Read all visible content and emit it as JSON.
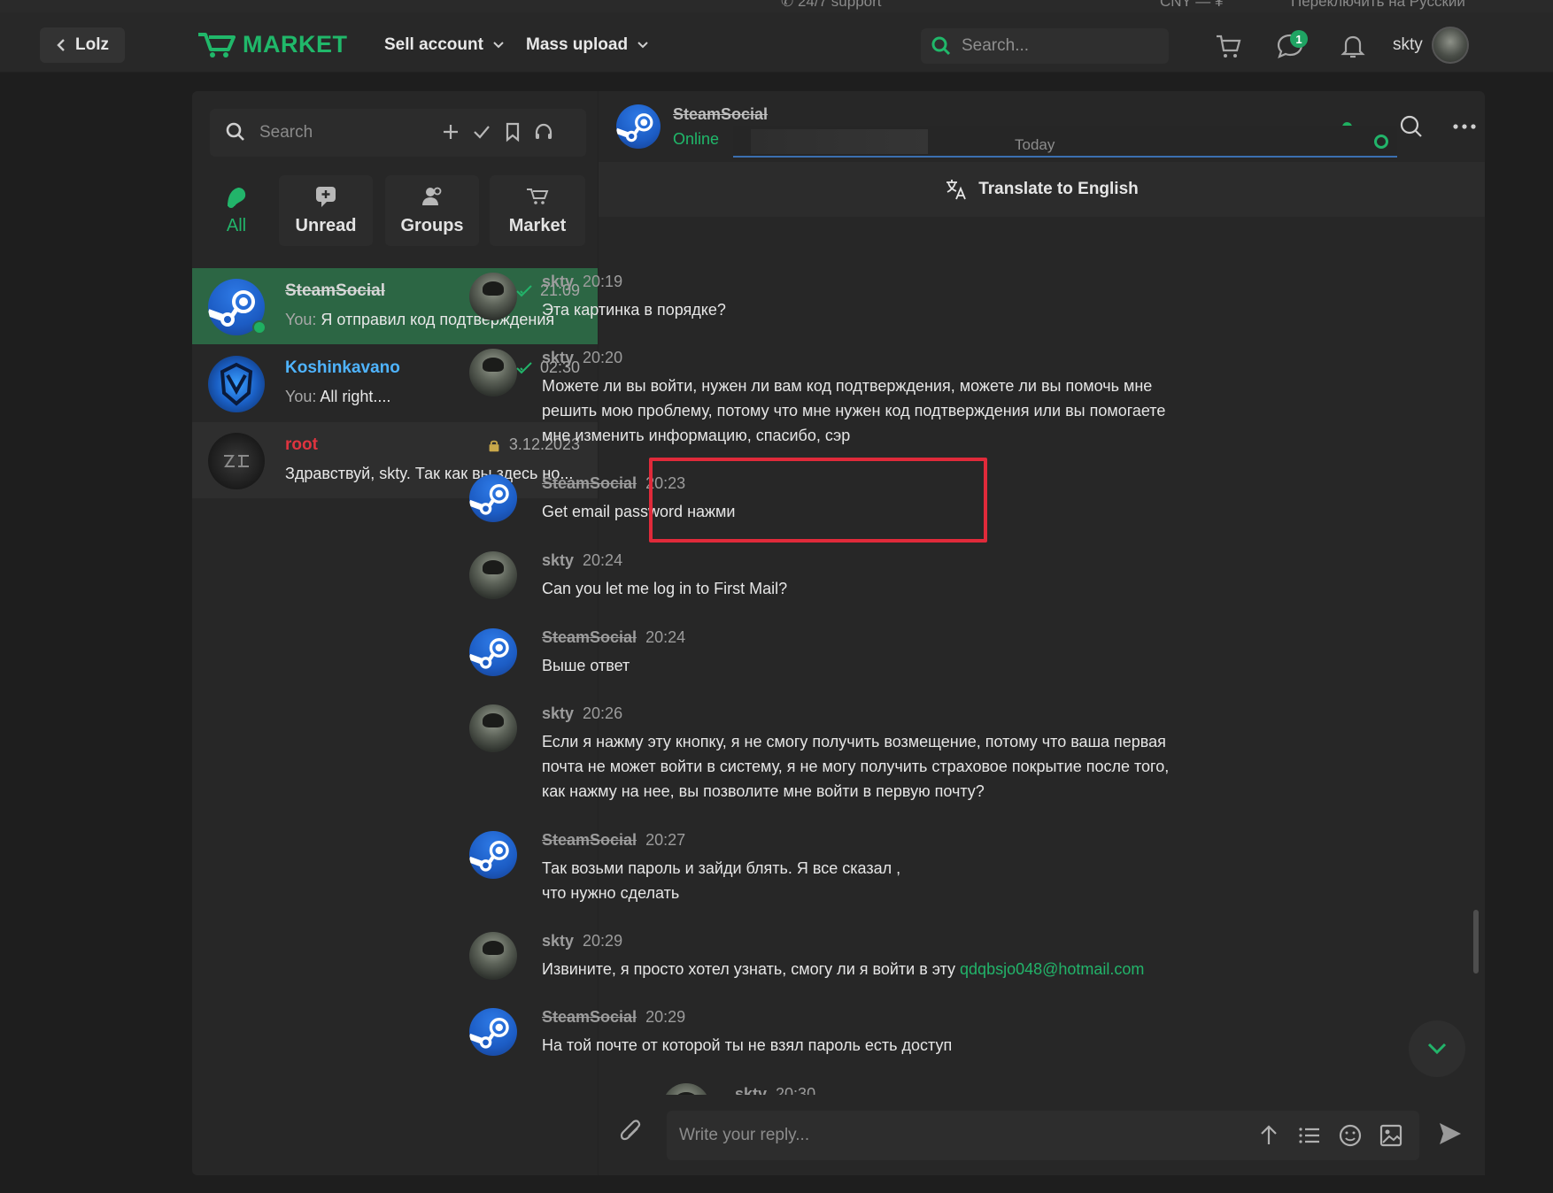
{
  "topbar": {
    "support": "24/7 support",
    "currency": "CNY — ¥",
    "language_switch": "Переключить на Русский"
  },
  "header": {
    "back_label": "Lolz",
    "logo_text": "MARKET",
    "nav": [
      "Sell account",
      "Mass upload"
    ],
    "search_placeholder": "Search...",
    "messages_badge": "1",
    "username": "skty"
  },
  "sidebar": {
    "search_placeholder": "Search",
    "tabs": [
      {
        "label": "All",
        "icon": "all-icon"
      },
      {
        "label": "Unread",
        "icon": "unread-icon"
      },
      {
        "label": "Groups",
        "icon": "groups-icon"
      },
      {
        "label": "Market",
        "icon": "market-icon"
      }
    ],
    "conversations": [
      {
        "name": "SteamSocial",
        "time": "21:09",
        "you": "You:",
        "preview": "Я отправил код подтверждения",
        "name_color": "#bfbfbf"
      },
      {
        "name": "Koshinkavano",
        "time": "02:30",
        "you": "You:",
        "preview": "All right....",
        "name_color": "#4fb4ff"
      },
      {
        "name": "root",
        "time": "3.12.2023",
        "you": "",
        "preview": "Здравствуй, skty. Так как вы здесь но...",
        "name_color": "#e0343f"
      }
    ]
  },
  "chat": {
    "contact_name": "SteamSocial",
    "contact_status": "Online",
    "translate_label": "Translate to English",
    "image_date_label": "Today",
    "reply_placeholder": "Write your reply...",
    "messages": [
      {
        "author": "skty",
        "time": "20:19",
        "lines": [
          "Эта картинка в порядке?"
        ]
      },
      {
        "author": "skty",
        "time": "20:20",
        "lines": [
          "Можете ли вы войти, нужен ли вам код подтверждения, можете ли вы помочь мне",
          "решить мою проблему, потому что мне нужен код подтверждения или вы помогаете",
          "мне изменить информацию, спасибо, сэр"
        ]
      },
      {
        "author": "SteamSocial",
        "time": "20:23",
        "lines": [
          "Get email password нажми"
        ]
      },
      {
        "author": "skty",
        "time": "20:24",
        "lines": [
          "Can you let me log in to First Mail?"
        ]
      },
      {
        "author": "SteamSocial",
        "time": "20:24",
        "lines": [
          "Выше ответ"
        ]
      },
      {
        "author": "skty",
        "time": "20:26",
        "lines": [
          "Если я нажму эту кнопку, я не смогу получить возмещение, потому что ваша первая",
          "почта не может войти в систему, я не могу получить страховое покрытие после того,",
          "как нажму на нее, вы позволите мне войти в первую почту?"
        ]
      },
      {
        "author": "SteamSocial",
        "time": "20:27",
        "lines": [
          "Так возьми пароль и зайди блять. Я все сказал ,",
          "что нужно сделать"
        ]
      },
      {
        "author": "skty",
        "time": "20:29",
        "text": "Извините, я просто хотел узнать, смогу ли я войти в эту ",
        "link": "qdqbsjo048@hotmail.com"
      },
      {
        "author": "SteamSocial",
        "time": "20:29",
        "lines": [
          "На той почте от которой ты не взял пароль есть доступ"
        ]
      },
      {
        "author": "skty",
        "time": "20:30",
        "lines": []
      }
    ]
  },
  "colors": {
    "accent_green": "#20b86a",
    "selected_row": "#2c6644",
    "highlight_box": "#e02a3a",
    "link": "#22b46a"
  }
}
